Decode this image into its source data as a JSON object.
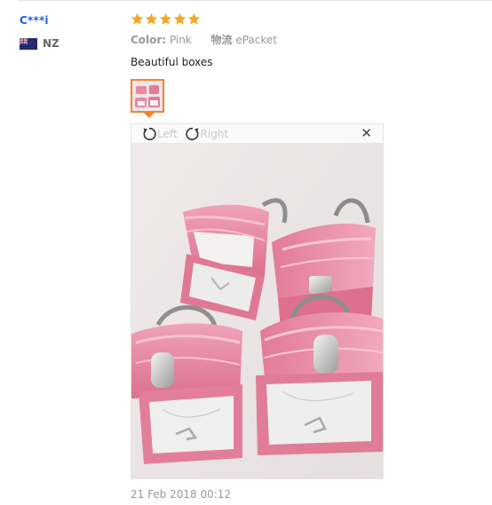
{
  "reviewer": {
    "name": "C***i",
    "country_code": "NZ",
    "flag_icon": "new-zealand-flag-icon"
  },
  "review": {
    "rating": 5,
    "rating_max": 5,
    "star_color": "#f5a623",
    "color_label": "Color:",
    "color_value": "Pink",
    "shipping_label": "物流",
    "shipping_value": "ePacket",
    "comment": "Beautiful boxes",
    "date": "21 Feb 2018 00:12"
  },
  "viewer": {
    "rotate_left_label": "Left",
    "rotate_right_label": "Right",
    "close_icon": "close-icon",
    "image_subject": "pink-handbag-shaped-jewelry-boxes"
  },
  "colors": {
    "username": "#1f5fd8",
    "thumb_border": "#f0852d"
  }
}
